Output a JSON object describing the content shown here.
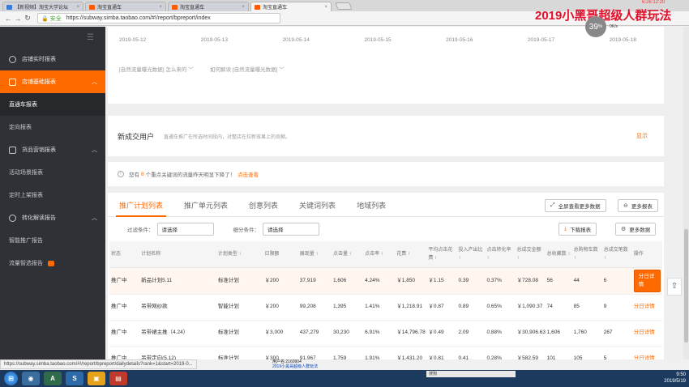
{
  "browser": {
    "tabs": [
      {
        "label": "【新视频】淘宝大学论坛"
      },
      {
        "label": "淘宝直通车"
      },
      {
        "label": "淘宝直通车"
      },
      {
        "label": "淘宝直通车"
      }
    ],
    "secure_label": "安全",
    "url": "https://subway.simba.taobao.com/#!/report/bpreport/index",
    "status_url": "https://subway.simba.taobao.com/#!/report/bpreport/dailydetails?rank=1&start=2019-0..."
  },
  "watermark": "2019小黑哥超级人群玩法",
  "overlay_clock": "6:26:12:20",
  "speed_widget": {
    "value": "39",
    "unit": "%",
    "rate": "0K/s"
  },
  "sidebar": {
    "items": [
      {
        "label": "店铺实时报表"
      },
      {
        "label": "店铺基础报表"
      },
      {
        "label": "直通车报表"
      },
      {
        "label": "定向报表"
      },
      {
        "label": "货品营销报表"
      },
      {
        "label": "活动场景报表"
      },
      {
        "label": "定时上架报表"
      },
      {
        "label": "转化解读报告"
      },
      {
        "label": "智能推广报告"
      },
      {
        "label": "流量智选报告"
      }
    ]
  },
  "dates": [
    "2019-05-12",
    "2019-05-13",
    "2019-05-14",
    "2019-05-15",
    "2019-05-16",
    "2019-05-17",
    "2019-05-18"
  ],
  "info_links": [
    "[自然流量曝光数据] 怎么来的",
    "如何解读 [自然流量曝光数据]"
  ],
  "new_users": {
    "title": "新成交用户",
    "desc": "直通车推广在所选时间段内，对整店在拉新效果上的贡献。",
    "show": "显示"
  },
  "notice": {
    "prefix": "您有",
    "count": "8",
    "suffix": "个重点关键词的流量昨天明显下降了！",
    "action": "点击查看"
  },
  "report": {
    "tabs": [
      {
        "label": "推广计划列表"
      },
      {
        "label": "推广单元列表"
      },
      {
        "label": "创意列表"
      },
      {
        "label": "关键词列表"
      },
      {
        "label": "地域列表"
      }
    ],
    "fullscreen_label": "全屏查看更多数据",
    "more_reports_label": "更多报表",
    "download_label": "下载报表",
    "more_data_label": "更多数据",
    "filter_label": "过滤条件：",
    "filter_placeholder": "请选择",
    "segment_label": "细分条件：",
    "segment_placeholder": "请选择",
    "columns": [
      "状态",
      "计划名称",
      "计划类型 ↑",
      "日限额",
      "展现量 ↑",
      "点击量 ↑",
      "点击率 ↑",
      "花费 ↑",
      "平均点击花费 ↑",
      "投入产出比 ↑",
      "点击转化率 ↑",
      "总成交金额 ↑",
      "总收藏数 ↑",
      "总购物车数 ↑",
      "总成交笔数 ↑",
      "操作"
    ],
    "rows": [
      {
        "status": "推广中",
        "name": "新品计划5.11",
        "type": "标准计划",
        "budget": "￥200",
        "impressions": "37,919",
        "clicks": "1,606",
        "ctr": "4.24%",
        "cost": "￥1,850",
        "cpc": "￥1.15",
        "roi": "0.39",
        "cvr": "0.37%",
        "gmv": "￥728.08",
        "favs": "56",
        "carts": "44",
        "orders": "6",
        "action": "分日详情"
      },
      {
        "status": "推广中",
        "name": "吊带网纱款",
        "type": "智能计划",
        "budget": "￥200",
        "impressions": "99,208",
        "clicks": "1,395",
        "ctr": "1.41%",
        "cost": "￥1,218.91",
        "cpc": "￥0.87",
        "roi": "0.89",
        "cvr": "0.65%",
        "gmv": "￥1,090.37",
        "favs": "74",
        "carts": "85",
        "orders": "9",
        "action": "分日详情"
      },
      {
        "status": "推广中",
        "name": "吊带裙主推（4.24）",
        "type": "标准计划",
        "budget": "￥3,000",
        "impressions": "437,279",
        "clicks": "30,230",
        "ctr": "6.91%",
        "cost": "￥14,796.78",
        "cpc": "￥0.49",
        "roi": "2.09",
        "cvr": "0.88%",
        "gmv": "￥30,906.63",
        "favs": "1,606",
        "carts": "1,760",
        "orders": "267",
        "action": "分日详情"
      },
      {
        "status": "推广中",
        "name": "吊带定向(5.12)",
        "type": "标准计划",
        "budget": "￥300",
        "impressions": "91,967",
        "clicks": "1,759",
        "ctr": "1.91%",
        "cost": "￥1,431.20",
        "cpc": "￥0.81",
        "roi": "0.41",
        "cvr": "0.28%",
        "gmv": "￥582.59",
        "favs": "101",
        "carts": "105",
        "orders": "5",
        "action": "分日详情"
      }
    ]
  },
  "caption": {
    "line1": "用户名:2160904",
    "line2": "2019小黑哥超级人群玩法"
  },
  "ime_label": "搜狗",
  "tray": {
    "time": "9:50",
    "date": "2019/5/19"
  }
}
